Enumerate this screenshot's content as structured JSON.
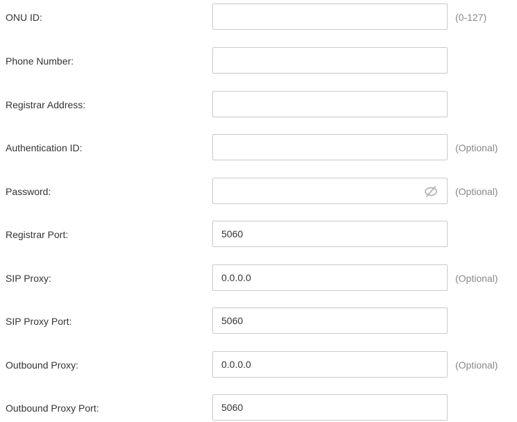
{
  "form": {
    "fields": [
      {
        "label": "ONU ID:",
        "value": "",
        "hint": "(0-127)"
      },
      {
        "label": "Phone Number:",
        "value": "",
        "hint": ""
      },
      {
        "label": "Registrar Address:",
        "value": "",
        "hint": ""
      },
      {
        "label": "Authentication ID:",
        "value": "",
        "hint": "(Optional)"
      },
      {
        "label": "Password:",
        "value": "",
        "hint": "(Optional)",
        "icon": "eye-slash-icon"
      },
      {
        "label": "Registrar Port:",
        "value": "5060",
        "hint": ""
      },
      {
        "label": "SIP Proxy:",
        "value": "0.0.0.0",
        "hint": "(Optional)"
      },
      {
        "label": "SIP Proxy Port:",
        "value": "5060",
        "hint": ""
      },
      {
        "label": "Outbound Proxy:",
        "value": "0.0.0.0",
        "hint": "(Optional)"
      },
      {
        "label": "Outbound Proxy Port:",
        "value": "5060",
        "hint": ""
      }
    ]
  },
  "colors": {
    "text": "#333333",
    "hint": "#888888",
    "border": "#c9c9c9"
  }
}
